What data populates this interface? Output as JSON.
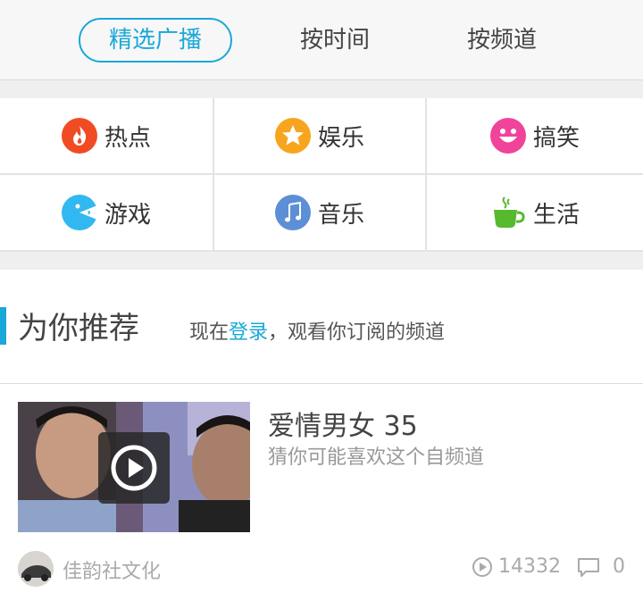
{
  "tabs": [
    {
      "label": "精选广播",
      "active": true
    },
    {
      "label": "按时间",
      "active": false
    },
    {
      "label": "按频道",
      "active": false
    }
  ],
  "categories": [
    {
      "label": "热点",
      "icon": "fire-icon",
      "color": "#f04b23"
    },
    {
      "label": "娱乐",
      "icon": "star-icon",
      "color": "#f7a51f"
    },
    {
      "label": "搞笑",
      "icon": "smile-icon",
      "color": "#f0449a"
    },
    {
      "label": "游戏",
      "icon": "pacman-icon",
      "color": "#32b8f0"
    },
    {
      "label": "音乐",
      "icon": "music-note-icon",
      "color": "#5d8fd6"
    },
    {
      "label": "生活",
      "icon": "coffee-cup-icon",
      "color": "#56b92e"
    }
  ],
  "recommend": {
    "title": "为你推荐",
    "prompt_before": "现在",
    "login_link": "登录",
    "prompt_after": "，观看你订阅的频道"
  },
  "item": {
    "title": "爱情男女 35",
    "desc": "猜你可能喜欢这个自频道",
    "author": "佳韵社文化",
    "plays": "14332",
    "comments": "0"
  },
  "colors": {
    "accent": "#1aa7d9"
  }
}
